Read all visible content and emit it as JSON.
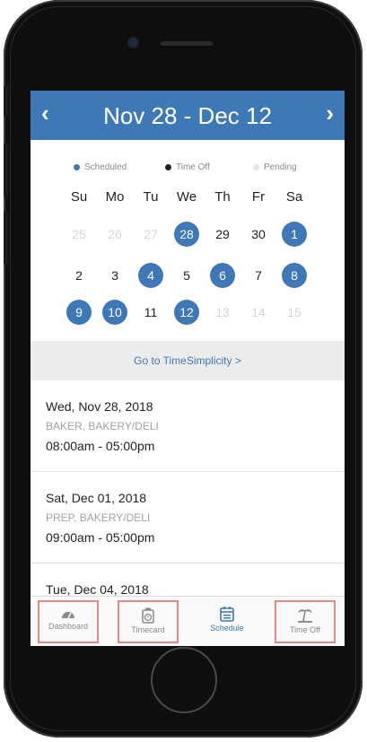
{
  "header": {
    "title": "Nov 28 - Dec 12",
    "prev": "‹",
    "next": "›"
  },
  "legend": [
    {
      "label": "Scheduled",
      "color": "#3f78b6"
    },
    {
      "label": "Time Off",
      "color": "#222222"
    },
    {
      "label": "Pending",
      "color": "#e6e6e6"
    }
  ],
  "weekdays": [
    "Su",
    "Mo",
    "Tu",
    "We",
    "Th",
    "Fr",
    "Sa"
  ],
  "calendar": {
    "weeks": [
      [
        {
          "d": "25",
          "s": "muted"
        },
        {
          "d": "26",
          "s": "muted"
        },
        {
          "d": "27",
          "s": "muted"
        },
        {
          "d": "28",
          "s": "sched"
        },
        {
          "d": "29",
          "s": "normal"
        },
        {
          "d": "30",
          "s": "normal"
        },
        {
          "d": "1",
          "s": "sched"
        }
      ],
      [
        {
          "d": "2",
          "s": "normal"
        },
        {
          "d": "3",
          "s": "normal"
        },
        {
          "d": "4",
          "s": "sched"
        },
        {
          "d": "5",
          "s": "normal"
        },
        {
          "d": "6",
          "s": "sched"
        },
        {
          "d": "7",
          "s": "normal"
        },
        {
          "d": "8",
          "s": "sched"
        }
      ],
      [
        {
          "d": "9",
          "s": "sched"
        },
        {
          "d": "10",
          "s": "sched"
        },
        {
          "d": "11",
          "s": "normal"
        },
        {
          "d": "12",
          "s": "sched"
        },
        {
          "d": "13",
          "s": "muted"
        },
        {
          "d": "14",
          "s": "muted"
        },
        {
          "d": "15",
          "s": "muted"
        }
      ]
    ]
  },
  "goto_link": "Go to TimeSimplicity >",
  "shifts": [
    {
      "date": "Wed, Nov 28, 2018",
      "role": "BAKER, BAKERY/DELI",
      "time": "08:00am - 05:00pm"
    },
    {
      "date": "Sat, Dec 01, 2018",
      "role": "PREP, BAKERY/DELI",
      "time": "09:00am - 05:00pm"
    },
    {
      "date": "Tue, Dec 04, 2018",
      "role": "",
      "time": ""
    }
  ],
  "tabs": [
    {
      "label": "Dashboard",
      "icon": "dashboard-gauge-icon",
      "active": false
    },
    {
      "label": "Timecard",
      "icon": "timecard-clock-icon",
      "active": false
    },
    {
      "label": "Schedule",
      "icon": "schedule-calendar-icon",
      "active": true
    },
    {
      "label": "Time Off",
      "icon": "time-off-beach-icon",
      "active": false
    }
  ]
}
